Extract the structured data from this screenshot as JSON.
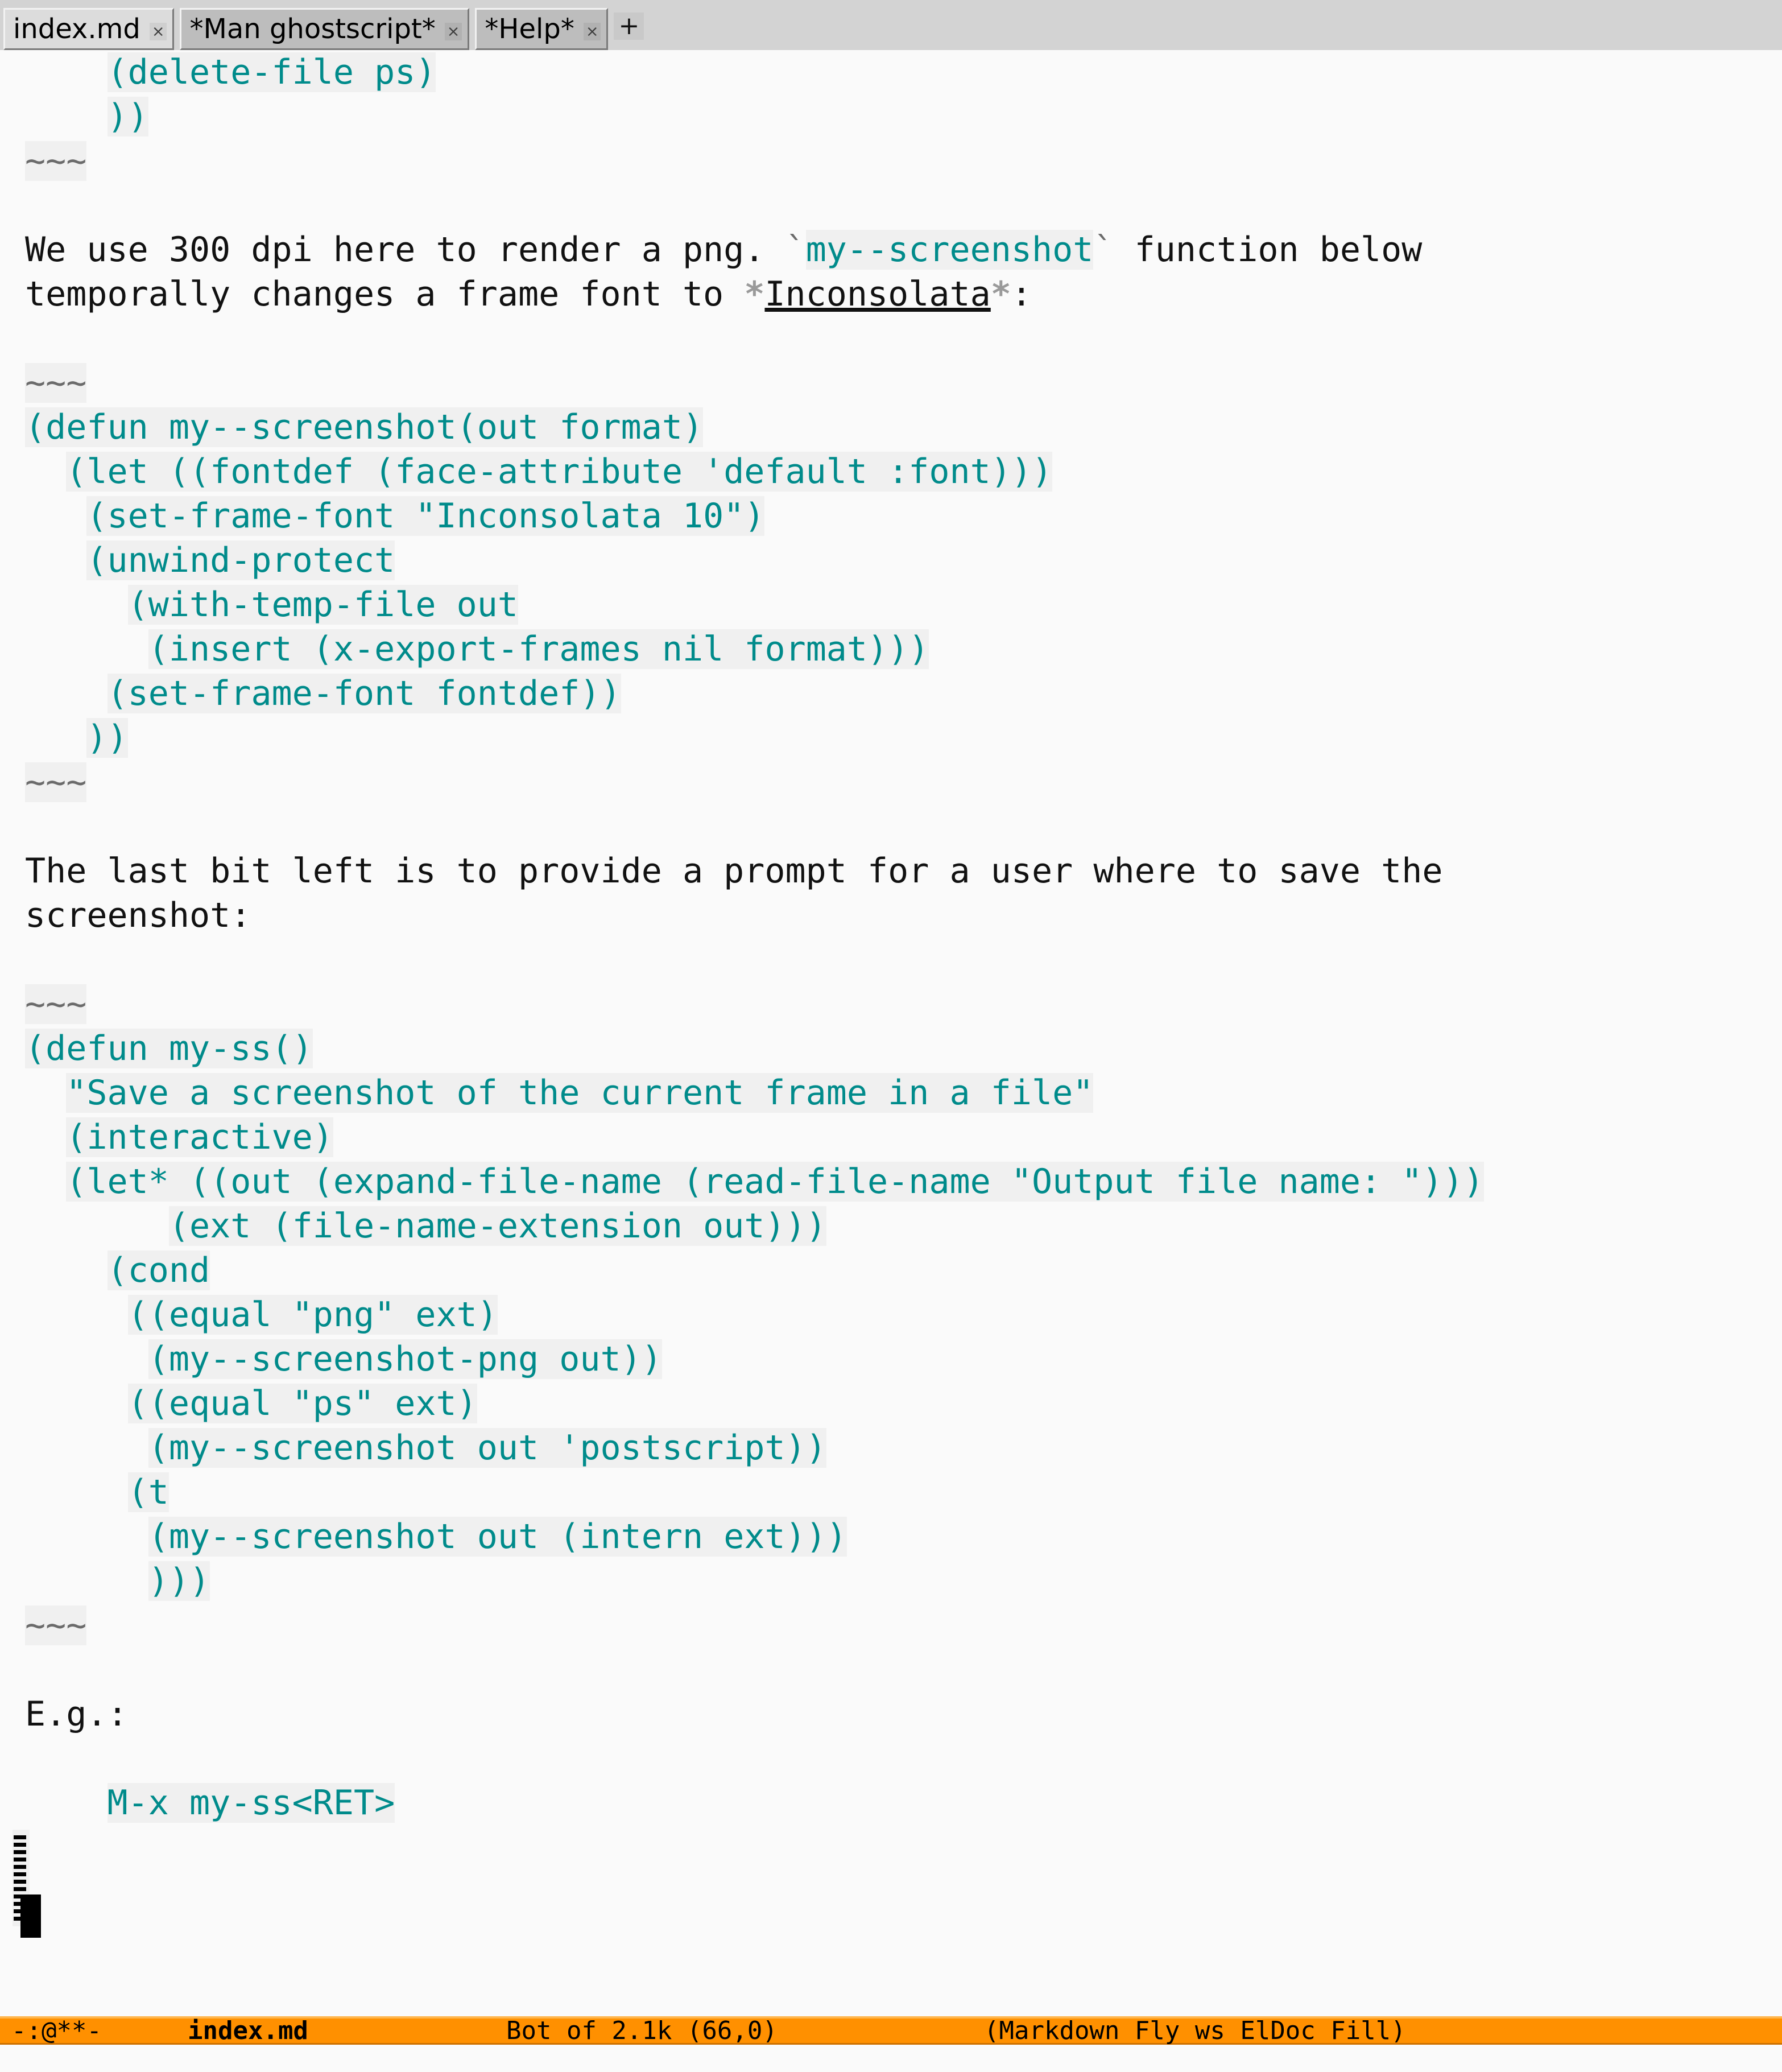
{
  "window": {
    "background": "#fafafa",
    "code_background": "#f0f0f0",
    "code_color": "#008b8b",
    "modeline_background": "#ff9000",
    "text_color": "#111111"
  },
  "tab_bar": {
    "tabs": [
      {
        "label": "index.md",
        "close": "×",
        "state": "selected"
      },
      {
        "label": "*Man ghostscript*",
        "close": "×",
        "state": "inactive"
      },
      {
        "label": "*Help*",
        "close": "×",
        "state": "inactive"
      }
    ],
    "new_tab_label": "+"
  },
  "buffer": {
    "lines": [
      {
        "id": "l01",
        "indent": 4,
        "segments": [
          {
            "face": "code",
            "text": "(delete-file ps)"
          }
        ]
      },
      {
        "id": "l02",
        "indent": 4,
        "segments": [
          {
            "face": "code",
            "text": "))"
          }
        ]
      },
      {
        "id": "l03",
        "indent": 0,
        "segments": [
          {
            "face": "fence",
            "text": "~~~"
          }
        ]
      },
      {
        "id": "l04",
        "indent": 0,
        "segments": []
      },
      {
        "id": "l05",
        "indent": 0,
        "segments": [
          {
            "face": "plain",
            "text": "We use 300 dpi here to render a png. "
          },
          {
            "face": "tick",
            "text": "`"
          },
          {
            "face": "inline",
            "text": "my--screenshot"
          },
          {
            "face": "tick",
            "text": "`"
          },
          {
            "face": "plain",
            "text": " function below"
          }
        ]
      },
      {
        "id": "l06",
        "indent": 0,
        "segments": [
          {
            "face": "plain",
            "text": "temporally changes a frame font to "
          },
          {
            "face": "emmark",
            "text": "*"
          },
          {
            "face": "em",
            "text": "Inconsolata"
          },
          {
            "face": "emmark",
            "text": "*"
          },
          {
            "face": "plain",
            "text": ":"
          }
        ]
      },
      {
        "id": "l07",
        "indent": 0,
        "segments": []
      },
      {
        "id": "l08",
        "indent": 0,
        "segments": [
          {
            "face": "fence",
            "text": "~~~"
          }
        ]
      },
      {
        "id": "l09",
        "indent": 0,
        "segments": [
          {
            "face": "code",
            "text": "(defun my--screenshot(out format)"
          }
        ]
      },
      {
        "id": "l10",
        "indent": 2,
        "segments": [
          {
            "face": "code",
            "text": "(let ((fontdef (face-attribute 'default :font)))"
          }
        ]
      },
      {
        "id": "l11",
        "indent": 3,
        "segments": [
          {
            "face": "code",
            "text": "(set-frame-font \"Inconsolata 10\")"
          }
        ]
      },
      {
        "id": "l12",
        "indent": 3,
        "segments": [
          {
            "face": "code",
            "text": "(unwind-protect"
          }
        ]
      },
      {
        "id": "l13",
        "indent": 5,
        "segments": [
          {
            "face": "code",
            "text": "(with-temp-file out"
          }
        ]
      },
      {
        "id": "l14",
        "indent": 6,
        "segments": [
          {
            "face": "code",
            "text": "(insert (x-export-frames nil format)))"
          }
        ]
      },
      {
        "id": "l15",
        "indent": 4,
        "segments": [
          {
            "face": "code",
            "text": "(set-frame-font fontdef))"
          }
        ]
      },
      {
        "id": "l16",
        "indent": 3,
        "segments": [
          {
            "face": "code",
            "text": "))"
          }
        ]
      },
      {
        "id": "l17",
        "indent": 0,
        "segments": [
          {
            "face": "fence",
            "text": "~~~"
          }
        ]
      },
      {
        "id": "l18",
        "indent": 0,
        "segments": []
      },
      {
        "id": "l19",
        "indent": 0,
        "segments": [
          {
            "face": "plain",
            "text": "The last bit left is to provide a prompt for a user where to save the"
          }
        ]
      },
      {
        "id": "l20",
        "indent": 0,
        "segments": [
          {
            "face": "plain",
            "text": "screenshot:"
          }
        ]
      },
      {
        "id": "l21",
        "indent": 0,
        "segments": []
      },
      {
        "id": "l22",
        "indent": 0,
        "segments": [
          {
            "face": "fence",
            "text": "~~~"
          }
        ]
      },
      {
        "id": "l23",
        "indent": 0,
        "segments": [
          {
            "face": "code",
            "text": "(defun my-ss()"
          }
        ]
      },
      {
        "id": "l24",
        "indent": 2,
        "segments": [
          {
            "face": "code",
            "text": "\"Save a screenshot of the current frame in a file\""
          }
        ]
      },
      {
        "id": "l25",
        "indent": 2,
        "segments": [
          {
            "face": "code",
            "text": "(interactive)"
          }
        ]
      },
      {
        "id": "l26",
        "indent": 2,
        "segments": [
          {
            "face": "code",
            "text": "(let* ((out (expand-file-name (read-file-name \"Output file name: \")))"
          }
        ]
      },
      {
        "id": "l27",
        "indent": 7,
        "segments": [
          {
            "face": "code",
            "text": "(ext (file-name-extension out)))"
          }
        ]
      },
      {
        "id": "l28",
        "indent": 4,
        "segments": [
          {
            "face": "code",
            "text": "(cond"
          }
        ]
      },
      {
        "id": "l29",
        "indent": 5,
        "segments": [
          {
            "face": "code",
            "text": "((equal \"png\" ext)"
          }
        ]
      },
      {
        "id": "l30",
        "indent": 6,
        "segments": [
          {
            "face": "code",
            "text": "(my--screenshot-png out))"
          }
        ]
      },
      {
        "id": "l31",
        "indent": 5,
        "segments": [
          {
            "face": "code",
            "text": "((equal \"ps\" ext)"
          }
        ]
      },
      {
        "id": "l32",
        "indent": 6,
        "segments": [
          {
            "face": "code",
            "text": "(my--screenshot out 'postscript))"
          }
        ]
      },
      {
        "id": "l33",
        "indent": 5,
        "segments": [
          {
            "face": "code",
            "text": "(t"
          }
        ]
      },
      {
        "id": "l34",
        "indent": 6,
        "segments": [
          {
            "face": "code",
            "text": "(my--screenshot out (intern ext)))"
          }
        ]
      },
      {
        "id": "l35",
        "indent": 6,
        "segments": [
          {
            "face": "code",
            "text": ")))"
          }
        ]
      },
      {
        "id": "l36",
        "indent": 0,
        "segments": [
          {
            "face": "fence",
            "text": "~~~"
          }
        ]
      },
      {
        "id": "l37",
        "indent": 0,
        "segments": []
      },
      {
        "id": "l38",
        "indent": 0,
        "segments": [
          {
            "face": "plain",
            "text": "E.g.:"
          }
        ]
      },
      {
        "id": "l39",
        "indent": 0,
        "segments": []
      },
      {
        "id": "l40",
        "indent": 4,
        "segments": [
          {
            "face": "code",
            "text": "M-x my-ss<RET>"
          }
        ]
      },
      {
        "id": "l41",
        "indent": 0,
        "segments": []
      }
    ]
  },
  "mode_line": {
    "flags": "-:@**-",
    "buffer_name": "index.md",
    "position": "Bot of 2.1k (66,0)",
    "modes": "(Markdown Fly ws ElDoc Fill)"
  }
}
